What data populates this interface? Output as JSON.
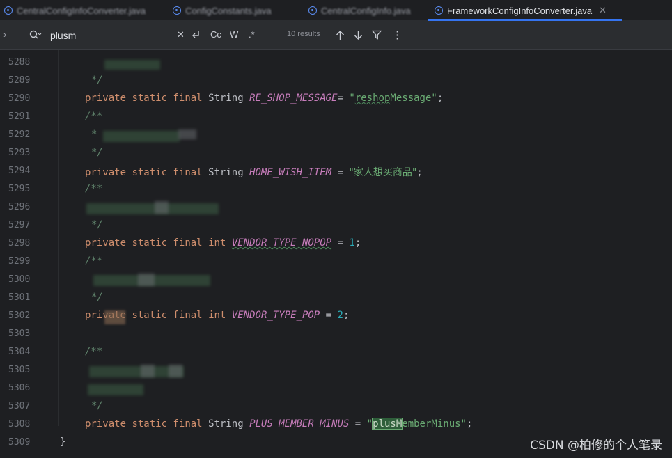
{
  "tabs": [
    {
      "label": "CentralConfigInfoConverter.java",
      "active": false
    },
    {
      "label": "ConfigConstants.java",
      "active": false
    },
    {
      "label": "CentralConfigInfo.java",
      "active": false
    },
    {
      "label": "FrameworkConfigInfoConverter.java",
      "active": true
    }
  ],
  "find": {
    "query": "plusm",
    "case_label": "Cc",
    "word_label": "W",
    "regex_label": ".*",
    "results": "10 results",
    "clear_icon": "close-icon",
    "replace_icon": "replace-icon"
  },
  "editor": {
    "lines": [
      {
        "no": "5288",
        "code": ""
      },
      {
        "no": "5289",
        "code": "*/"
      },
      {
        "no": "5290",
        "code": "private static final String RE_SHOP_MESSAGE= \"reshopMessage\";"
      },
      {
        "no": "5291",
        "code": "/**"
      },
      {
        "no": "5292",
        "code": "*"
      },
      {
        "no": "5293",
        "code": "*/"
      },
      {
        "no": "5294",
        "code": "private static final String HOME_WISH_ITEM = \"家人想买商品\";"
      },
      {
        "no": "5295",
        "code": "/**"
      },
      {
        "no": "5296",
        "code": ""
      },
      {
        "no": "5297",
        "code": "*/"
      },
      {
        "no": "5298",
        "code": "private static final int VENDOR_TYPE_NOPOP = 1;"
      },
      {
        "no": "5299",
        "code": "/**"
      },
      {
        "no": "5300",
        "code": ""
      },
      {
        "no": "5301",
        "code": "*/"
      },
      {
        "no": "5302",
        "code": "private static final int VENDOR_TYPE_POP = 2;"
      },
      {
        "no": "5303",
        "code": ""
      },
      {
        "no": "5304",
        "code": "/**"
      },
      {
        "no": "5305",
        "code": ""
      },
      {
        "no": "5306",
        "code": ""
      },
      {
        "no": "5307",
        "code": "*/"
      },
      {
        "no": "5308",
        "code": "private static final String PLUS_MEMBER_MINUS = \"plusMemberMinus\";"
      },
      {
        "no": "5309",
        "code": "}"
      }
    ],
    "tokens": {
      "kw_private": "private",
      "kw_static": "static",
      "kw_final": "final",
      "t_string": "String",
      "t_int": "int",
      "c1": "RE_SHOP_MESSAGE",
      "s1a": "\"",
      "s1b": "reshop",
      "s1c": "Message\"",
      "c2": "HOME_WISH_ITEM",
      "s2": "\"家人想买商品\"",
      "c3": "VENDOR_TYPE_NOPOP",
      "n3": "1",
      "c4": "VENDOR_TYPE_POP",
      "n4": "2",
      "c5": "PLUS_MEMBER_MINUS",
      "s5a": "\"",
      "s5hl": "plusM",
      "s5b": "emberMinus\"",
      "open_comment": "/**",
      "close_comment": "*/",
      "star": "*",
      "brace": "}",
      "eq": "=",
      "semi": ";",
      "eqsp": " = "
    }
  },
  "watermark": "CSDN @柏修的个人笔录",
  "colors": {
    "keyword": "#cf8e6d",
    "constant": "#c77dbb",
    "string": "#6aab73",
    "number": "#2aacb8",
    "comment": "#5f826b",
    "accent": "#3574f0"
  }
}
